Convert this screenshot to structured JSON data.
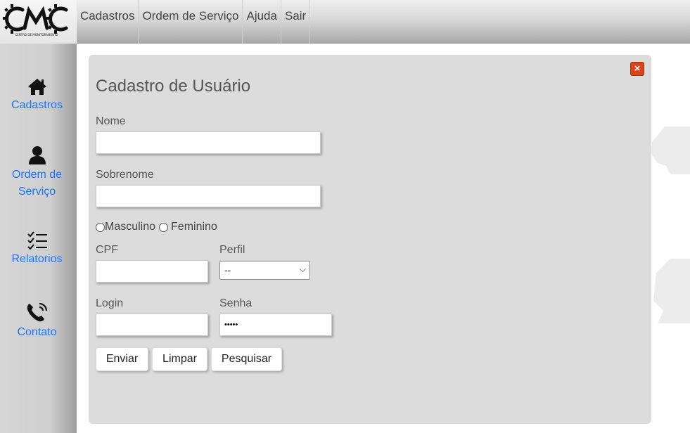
{
  "logo": {
    "letters": "CMC",
    "tagline": "CENTRO DE MONITORAMENTO"
  },
  "topnav": {
    "items": [
      "Cadastros",
      "Ordem de Serviço",
      "Ajuda",
      "Sair"
    ]
  },
  "sidebar": {
    "items": [
      {
        "label": "Cadastros",
        "icon": "home-icon"
      },
      {
        "label": "Ordem de Serviço",
        "line1": "Ordem de",
        "line2": "Serviço",
        "icon": "user-icon"
      },
      {
        "label": "Relatorios",
        "icon": "checklist-icon"
      },
      {
        "label": "Contato",
        "icon": "phone-icon"
      }
    ]
  },
  "form": {
    "title": "Cadastro de Usuário",
    "close_symbol": "×",
    "fields": {
      "nome": {
        "label": "Nome",
        "value": ""
      },
      "sobrenome": {
        "label": "Sobrenome",
        "value": ""
      },
      "cpf": {
        "label": "CPF",
        "value": ""
      },
      "perfil": {
        "label": "Perfil",
        "selected": "--"
      },
      "login": {
        "label": "Login",
        "value": ""
      },
      "senha": {
        "label": "Senha",
        "value": "•••••"
      }
    },
    "gender": {
      "options": [
        "Masculino",
        "Feminino"
      ]
    },
    "buttons": {
      "enviar": "Enviar",
      "limpar": "Limpar",
      "pesquisar": "Pesquisar"
    }
  },
  "colors": {
    "accent": "#1d73f5",
    "close": "#d9441c",
    "panel": "#dcdcdc"
  }
}
